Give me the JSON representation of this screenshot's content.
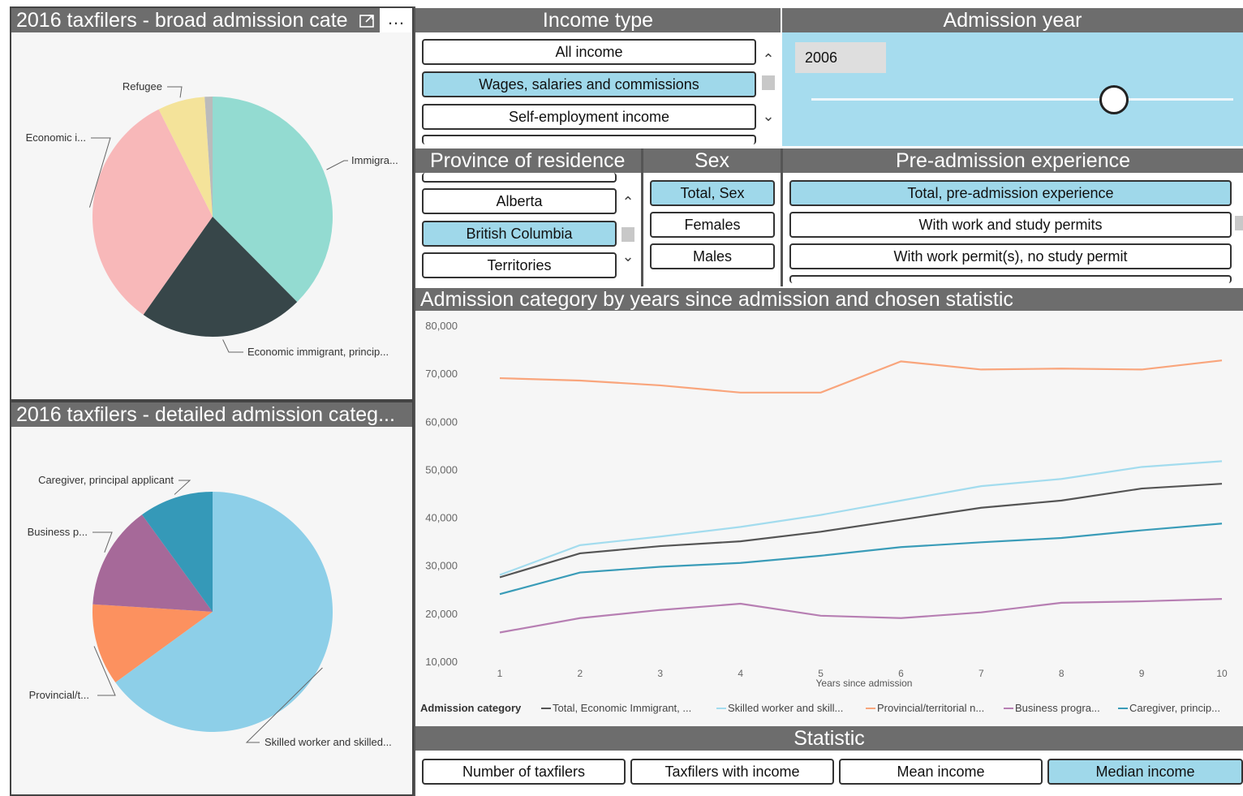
{
  "broad_panel": {
    "title": "2016 taxfilers - broad admission cate",
    "focus_icon": "focus-mode-icon",
    "more_icon": "ellipsis-icon",
    "more_glyph": "…"
  },
  "detailed_panel": {
    "title": "2016 taxfilers - detailed admission categ..."
  },
  "income_type": {
    "title": "Income type",
    "options": [
      "All income",
      "Wages, salaries and commissions",
      "Self-employment income"
    ],
    "selected": "Wages, salaries and commissions"
  },
  "admission_year": {
    "title": "Admission year",
    "value": "2006"
  },
  "province": {
    "title": "Province of residence",
    "options": [
      "Alberta",
      "British Columbia",
      "Territories"
    ],
    "selected": "British Columbia"
  },
  "sex": {
    "title": "Sex",
    "options": [
      "Total, Sex",
      "Females",
      "Males"
    ],
    "selected": "Total, Sex"
  },
  "pre_admission": {
    "title": "Pre-admission experience",
    "options": [
      "Total, pre-admission experience",
      "With work and study permits",
      "With work permit(s), no study permit"
    ],
    "selected": "Total, pre-admission experience"
  },
  "line_panel": {
    "title": "Admission category by years since admission and chosen statistic"
  },
  "statistic": {
    "title": "Statistic",
    "options": [
      "Number of taxfilers",
      "Taxfilers with income",
      "Mean income",
      "Median income"
    ],
    "selected": "Median income"
  },
  "colors": {
    "header_gray": "#6d6d6d",
    "selected_blue": "#9fd8ea",
    "slider_bg": "#a6dcee"
  },
  "chart_data": [
    {
      "type": "pie",
      "labels": [
        "Immigra...",
        "Economic immigrant, princip...",
        "Economic i...",
        "Refugee",
        ""
      ],
      "values": [
        35.5,
        21,
        31,
        6,
        1
      ],
      "colors": [
        "#93dbd1",
        "#374649",
        "#f8b8b9",
        "#f4e39a",
        "#bbbbbb"
      ]
    },
    {
      "type": "pie",
      "labels": [
        "Skilled worker and skilled...",
        "Provincial/t...",
        "Business p...",
        "Caregiver, principal applicant"
      ],
      "values": [
        65,
        11,
        14,
        10
      ],
      "colors": [
        "#8dcfe8",
        "#fc915f",
        "#a66999",
        "#3599b8"
      ]
    },
    {
      "type": "line",
      "xlabel": "Years since admission",
      "x": [
        1,
        2,
        3,
        4,
        5,
        6,
        7,
        8,
        9,
        10
      ],
      "ylim": [
        10000,
        80000
      ],
      "yticks": [
        "10,000",
        "20,000",
        "30,000",
        "40,000",
        "50,000",
        "60,000",
        "70,000",
        "80,000"
      ],
      "legend_title": "Admission category",
      "series": [
        {
          "name": "Total, Economic Immigrant, ...",
          "color": "#555555",
          "values": [
            27500,
            32500,
            34000,
            35000,
            37000,
            39500,
            42000,
            43500,
            46000,
            47000
          ]
        },
        {
          "name": "Skilled worker and skill...",
          "color": "#a3dcee",
          "values": [
            28000,
            34200,
            36000,
            38000,
            40500,
            43500,
            46500,
            48000,
            50500,
            51700
          ]
        },
        {
          "name": "Provincial/territorial n...",
          "color": "#f9a57c",
          "values": [
            69000,
            68500,
            67500,
            66000,
            66000,
            72500,
            70800,
            71000,
            70800,
            72700
          ]
        },
        {
          "name": "Business progra...",
          "color": "#b77fb3",
          "values": [
            16000,
            19000,
            20700,
            22000,
            19500,
            19000,
            20200,
            22200,
            22500,
            23000
          ]
        },
        {
          "name": "Caregiver, princip...",
          "color": "#3a9cb8",
          "values": [
            24000,
            28500,
            29700,
            30500,
            32000,
            33800,
            34800,
            35700,
            37300,
            38700
          ]
        }
      ]
    }
  ]
}
